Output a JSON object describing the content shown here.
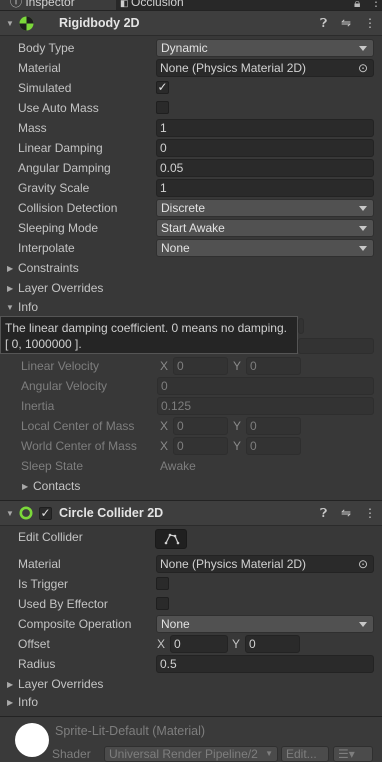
{
  "tabs": {
    "inspector": "Inspector",
    "occlusion": "Occlusion"
  },
  "rigidbody": {
    "title": "Rigidbody 2D",
    "body_type": {
      "label": "Body Type",
      "value": "Dynamic"
    },
    "material": {
      "label": "Material",
      "value": "None (Physics Material 2D)"
    },
    "simulated": {
      "label": "Simulated"
    },
    "use_auto_mass": {
      "label": "Use Auto Mass"
    },
    "mass": {
      "label": "Mass",
      "value": "1"
    },
    "linear_damping": {
      "label": "Linear Damping",
      "value": "0"
    },
    "angular_damping": {
      "label": "Angular Damping",
      "value": "0.05"
    },
    "gravity_scale": {
      "label": "Gravity Scale",
      "value": "1"
    },
    "collision_detection": {
      "label": "Collision Detection",
      "value": "Discrete"
    },
    "sleeping_mode": {
      "label": "Sleeping Mode",
      "value": "Start Awake"
    },
    "interpolate": {
      "label": "Interpolate",
      "value": "None"
    },
    "constraints": "Constraints",
    "layer_overrides": "Layer Overrides",
    "info": "Info",
    "tooltip": "The linear damping coefficient. 0 means no damping. [ 0, 1000000 ].",
    "linear_velocity": {
      "label": "Linear Velocity",
      "x": "0",
      "y": "0"
    },
    "angular_velocity": {
      "label": "Angular Velocity",
      "value": "0"
    },
    "inertia": {
      "label": "Inertia",
      "value": "0.125"
    },
    "local_com": {
      "label": "Local Center of Mass",
      "x": "0",
      "y": "0"
    },
    "world_com": {
      "label": "World Center of Mass",
      "x": "0",
      "y": "0"
    },
    "sleep_state": {
      "label": "Sleep State",
      "value": "Awake"
    },
    "contacts": "Contacts"
  },
  "circle_collider": {
    "title": "Circle Collider 2D",
    "edit_collider": {
      "label": "Edit Collider"
    },
    "material": {
      "label": "Material",
      "value": "None (Physics Material 2D)"
    },
    "is_trigger": {
      "label": "Is Trigger"
    },
    "used_by_effector": {
      "label": "Used By Effector"
    },
    "composite_operation": {
      "label": "Composite Operation",
      "value": "None"
    },
    "offset": {
      "label": "Offset",
      "x": "0",
      "y": "0"
    },
    "radius": {
      "label": "Radius",
      "value": "0.5"
    },
    "layer_overrides": "Layer Overrides",
    "info": "Info"
  },
  "material_section": {
    "name": "Sprite-Lit-Default (Material)",
    "shader_label": "Shader",
    "shader_value": "Universal Render Pipeline/2",
    "edit_label": "Edit..."
  },
  "axis": {
    "x": "X",
    "y": "Y"
  },
  "colors": {
    "accent_green": "#7bd83a",
    "background": "#383838"
  }
}
